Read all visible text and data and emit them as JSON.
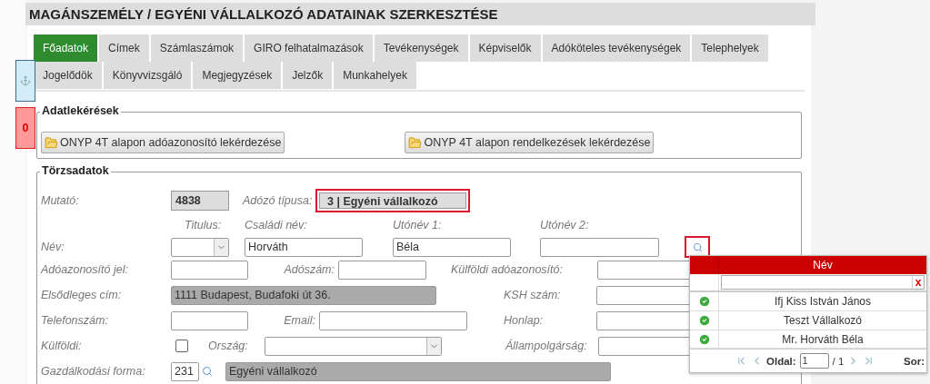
{
  "title": "MAGÁNSZEMÉLY / EGYÉNI VÁLLALKOZÓ ADATAINAK SZERKESZTÉSE",
  "side_tabs": [
    {
      "kind": "anchor"
    },
    {
      "kind": "count",
      "label": "0"
    }
  ],
  "tab_rows": [
    {
      "tabs": [
        {
          "label": "Főadatok",
          "selected": true
        },
        {
          "label": "Címek",
          "selected": false
        },
        {
          "label": "Számlaszámok",
          "selected": false
        },
        {
          "label": "GIRO felhatalmazások",
          "selected": false
        },
        {
          "label": "Tevékenységek",
          "selected": false
        },
        {
          "label": "Képviselők",
          "selected": false
        },
        {
          "label": "Adóköteles tevékenységek",
          "selected": false
        },
        {
          "label": "Telephelyek",
          "selected": false
        }
      ]
    },
    {
      "tabs": [
        {
          "label": "Jogelődök",
          "selected": false
        },
        {
          "label": "Könyvvizsgáló",
          "selected": false
        },
        {
          "label": "Megjegyzések",
          "selected": false
        },
        {
          "label": "Jelzők",
          "selected": false
        },
        {
          "label": "Munkahelyek",
          "selected": false
        }
      ]
    }
  ],
  "data_queries": {
    "legend": "Adatlekérések",
    "buttons": [
      "ONYP 4T alapon adóazonosító lekérdezése",
      "ONYP 4T alapon rendelkezések lekérdezése"
    ]
  },
  "master_data": {
    "legend": "Törzsadatok",
    "mutato": {
      "label": "Mutató:",
      "value": "4838"
    },
    "taxpayer_type": {
      "label": "Adózó típusa:",
      "value": "3 | Egyéni vállalkozó"
    },
    "name": {
      "label": "Név:",
      "title_label": "Titulus:",
      "family_label": "Családi név:",
      "family_value": "Horváth",
      "given1_label": "Utónév 1:",
      "given1_value": "Béla",
      "given2_label": "Utónév 2:"
    },
    "tax_id": {
      "label": "Adóazonosító jel:"
    },
    "tax_number": {
      "label": "Adószám:"
    },
    "foreign_tax_id": {
      "label": "Külföldi adóazonosító:"
    },
    "primary_address": {
      "label": "Elsődleges cím:",
      "value": "1111 Budapest, Budafoki út 36."
    },
    "ksh": {
      "label": "KSH szám:"
    },
    "phone": {
      "label": "Telefonszám:"
    },
    "email": {
      "label": "Email:"
    },
    "website": {
      "label": "Honlap:"
    },
    "foreign": {
      "label": "Külföldi:",
      "checked": false
    },
    "country": {
      "label": "Ország:"
    },
    "citizenship": {
      "label": "Állampolgárság:"
    },
    "business_form": {
      "label": "Gazdálkodási forma:",
      "code": "231",
      "value": "Egyéni vállalkozó"
    }
  },
  "name_lookup": {
    "column": "Név",
    "clear": "x",
    "rows": [
      {
        "name": "Ifj Kiss István János",
        "valid": true
      },
      {
        "name": "Teszt Vállalkozó",
        "valid": true
      },
      {
        "name": "Mr. Horváth Béla",
        "valid": true
      }
    ],
    "pager": {
      "page_label": "Oldal:",
      "page": "1",
      "total": "/ 1",
      "rows_label": "Sor:"
    }
  }
}
